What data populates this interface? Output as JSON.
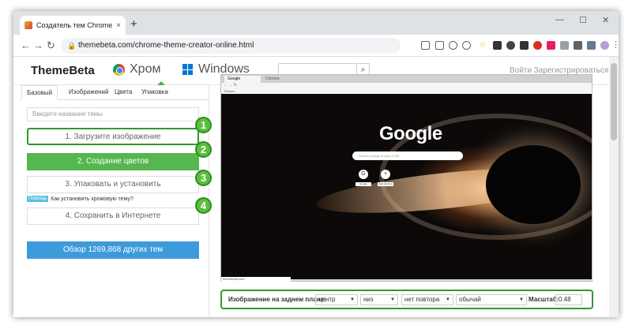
{
  "browser": {
    "tab_title": "Создатель тем Chrome - создат",
    "tab_close": "×",
    "new_tab": "+",
    "window_controls": [
      "—",
      "☐",
      "✕"
    ],
    "url": "themebeta.com/chrome-theme-creator-online.html"
  },
  "site": {
    "logo": "ThemeBeta",
    "brand_chrome": "Хром",
    "brand_windows": "Windows",
    "search_placeholder": "",
    "login": "Войти Зарегистрироваться"
  },
  "panel": {
    "tabs": [
      "Базовый",
      "Изображений",
      "Цвета",
      "Упаковка"
    ],
    "name_placeholder": "Введите название темы",
    "steps": [
      "1. Загрузите изображение",
      "2. Создание цветов",
      "3. Упаковать и установить",
      "4. Сохранить в Интернете"
    ],
    "numbers": [
      "1",
      "2",
      "3",
      "4"
    ],
    "help_badge": "Помощь",
    "help_text": "Как установить хромовую тему?",
    "browse": "Обзор 1269,868 других тем"
  },
  "preview": {
    "tab1": "Google",
    "tab2": "Chrome",
    "bookmark": "Themes",
    "google": "Google",
    "search_placeholder": "Search Google or type a URL",
    "shortcut1": "G",
    "shortcut2": "+",
    "shortcut1_label": "Google",
    "shortcut2_label": "Add shortcut",
    "footer": "themebeta.com"
  },
  "controls": {
    "label": "Изображение на заднем плане:",
    "position_h": "центр",
    "position_v": "низ",
    "repeat": "нет повтора",
    "style": "обычай",
    "scale_label": "Масштаб:",
    "scale_value": "0.48"
  },
  "colors": {
    "green": "#55b74f",
    "blue": "#3e9bdb",
    "highlight": "#2e9a2e"
  }
}
